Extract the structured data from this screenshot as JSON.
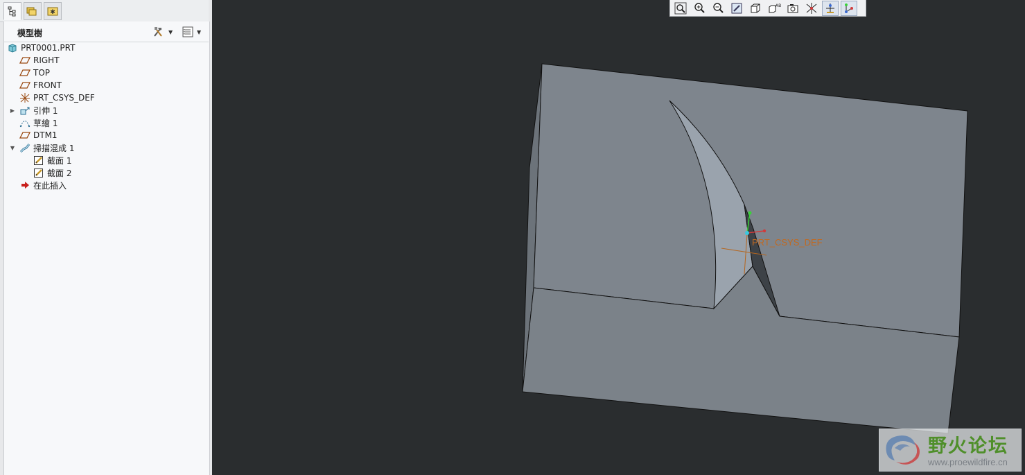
{
  "left_panel": {
    "tabs": [
      {
        "icon": "model-tree-icon"
      },
      {
        "icon": "folder-browser-icon"
      },
      {
        "icon": "favorites-icon"
      }
    ],
    "tree_title": "模型樹",
    "settings_icon": "tree-settings-icon",
    "columns_icon": "tree-columns-icon"
  },
  "tree": [
    {
      "label": "PRT0001.PRT",
      "icon": "part-icon",
      "level": 0
    },
    {
      "label": "RIGHT",
      "icon": "datum-plane-icon",
      "level": 1
    },
    {
      "label": "TOP",
      "icon": "datum-plane-icon",
      "level": 1
    },
    {
      "label": "FRONT",
      "icon": "datum-plane-icon",
      "level": 1
    },
    {
      "label": "PRT_CSYS_DEF",
      "icon": "csys-icon",
      "level": 1
    },
    {
      "label": "引伸 1",
      "icon": "extrude-icon",
      "level": 1,
      "expander": "collapsed"
    },
    {
      "label": "草繪 1",
      "icon": "sketch-icon",
      "level": 1
    },
    {
      "label": "DTM1",
      "icon": "datum-plane-icon",
      "level": 1
    },
    {
      "label": "掃描混成 1",
      "icon": "swept-blend-icon",
      "level": 1,
      "expander": "expanded"
    },
    {
      "label": "截面 1",
      "icon": "section-icon",
      "level": 2
    },
    {
      "label": "截面 2",
      "icon": "section-icon",
      "level": 2
    },
    {
      "label": "在此插入",
      "icon": "insert-here-arrow-icon",
      "level": 1
    }
  ],
  "view_toolbar": [
    {
      "icon": "refit-icon"
    },
    {
      "icon": "zoom-in-icon"
    },
    {
      "icon": "zoom-out-icon"
    },
    {
      "icon": "repaint-icon"
    },
    {
      "icon": "display-style-icon"
    },
    {
      "icon": "saved-orientations-icon"
    },
    {
      "icon": "view-manager-icon"
    },
    {
      "icon": "datum-display-icon"
    },
    {
      "icon": "spin-center-icon"
    },
    {
      "icon": "annotation-display-icon"
    }
  ],
  "viewport": {
    "csys_label": "PRT_CSYS_DEF",
    "background": "#2a2d2f",
    "model_color": "#7e858d"
  },
  "watermark": {
    "text": "野火论坛",
    "url": "www.proewildfire.cn"
  }
}
